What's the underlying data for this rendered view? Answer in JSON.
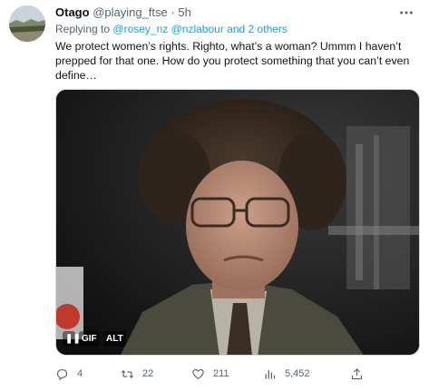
{
  "author": {
    "display_name": "Otago",
    "handle": "@playing_ftse",
    "separator": "·",
    "timestamp": "5h",
    "avatar_icon": "landscape-avatar"
  },
  "more_icon": "more-horizontal-icon",
  "replying": {
    "prefix": "Replying to",
    "mentions": [
      "@rosey_nz",
      "@nzlabour"
    ],
    "conjunction": "and",
    "others": "2 others"
  },
  "tweet": {
    "text": "We protect women’s rights. Righto, what’s a woman? Ummm I haven’t prepped for that one. How do you protect something that you can’t even define…"
  },
  "media": {
    "type": "gif",
    "pause_label": "❚❚",
    "gif_label": "GIF",
    "alt_label": "ALT"
  },
  "actions": {
    "reply": {
      "icon": "reply-icon",
      "count": "4"
    },
    "retweet": {
      "icon": "retweet-icon",
      "count": "22"
    },
    "like": {
      "icon": "heart-icon",
      "count": "211"
    },
    "views": {
      "icon": "analytics-icon",
      "count": "5,452"
    },
    "share": {
      "icon": "share-icon",
      "count": ""
    }
  },
  "colors": {
    "text": "#0f1419",
    "secondary": "#536471",
    "link": "#1d9bf0"
  }
}
